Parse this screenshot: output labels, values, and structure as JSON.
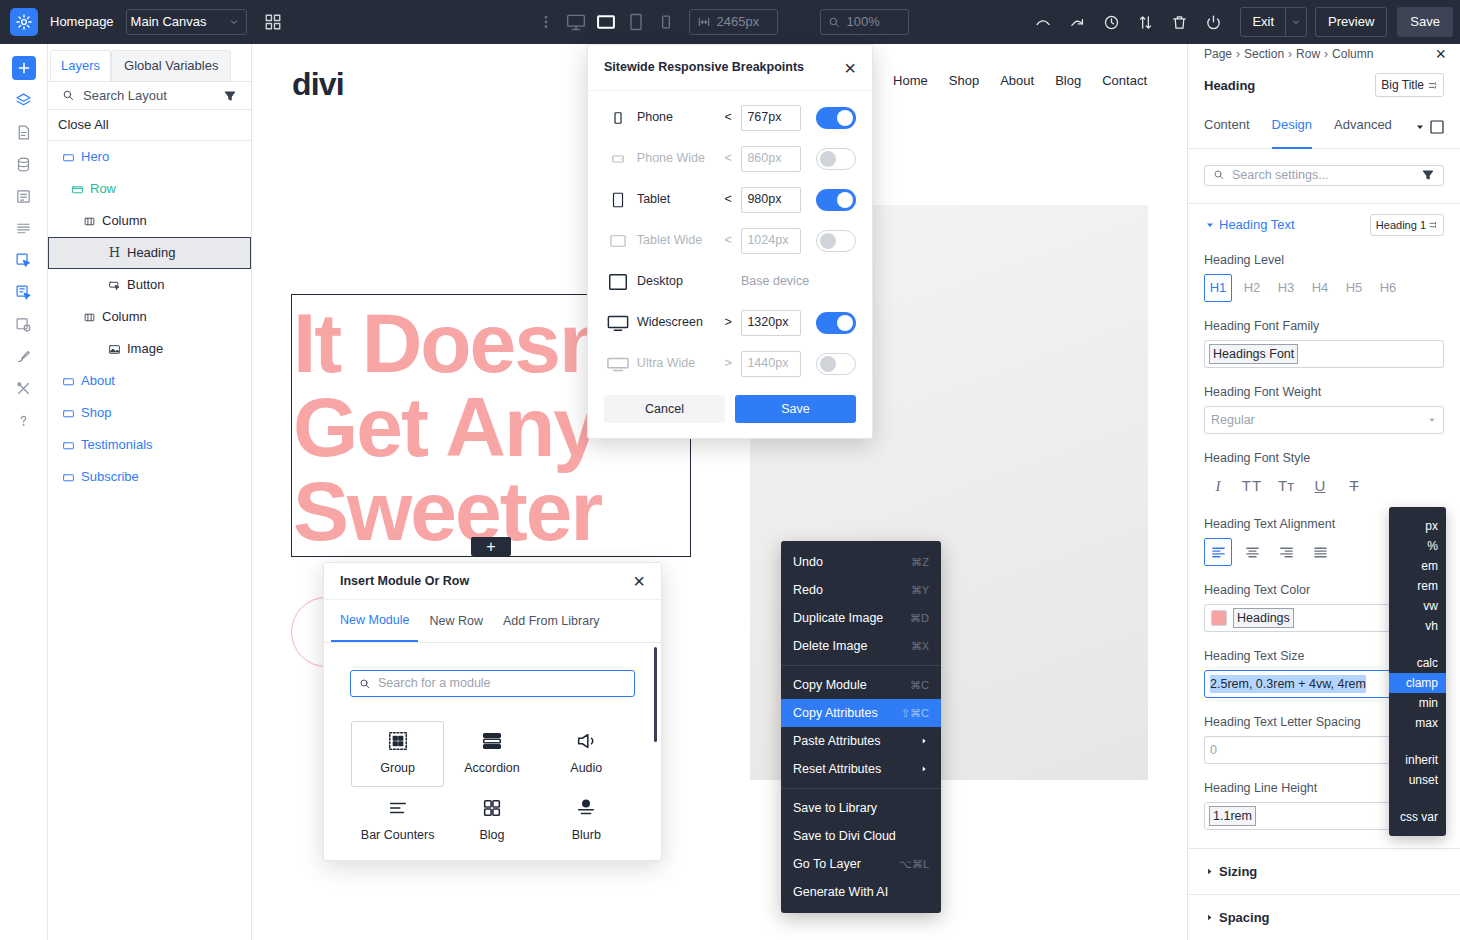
{
  "topbar": {
    "page_title": "Homepage",
    "canvas": "Main Canvas",
    "devices": [
      {
        "kind": "desktop",
        "selected": false
      },
      {
        "kind": "tablet-landscape",
        "selected": true
      },
      {
        "kind": "tablet",
        "selected": false
      },
      {
        "kind": "phone",
        "selected": false
      }
    ],
    "width": "2465px",
    "zoom": "100%",
    "exit": "Exit",
    "preview": "Preview",
    "save": "Save"
  },
  "rail": [
    {
      "kind": "add",
      "selected": false
    },
    {
      "kind": "tool",
      "selected": true
    },
    {
      "kind": "tool",
      "selected": false
    },
    {
      "kind": "tool",
      "selected": false
    },
    {
      "kind": "tool",
      "selected": false
    },
    {
      "kind": "tool",
      "selected": false
    },
    {
      "kind": "tool",
      "selected": true
    },
    {
      "kind": "tool",
      "selected": true
    },
    {
      "kind": "tool",
      "selected": false
    },
    {
      "kind": "tool",
      "selected": false
    },
    {
      "kind": "tool",
      "selected": false
    },
    {
      "kind": "tool",
      "selected": false
    }
  ],
  "layers": {
    "tabs": [
      {
        "label": "Layers",
        "selected": true
      },
      {
        "label": "Global Variables",
        "selected": false
      }
    ],
    "search": "Search Layout",
    "close_all": "Close All",
    "tree": [
      {
        "label": "Hero",
        "kind": "section",
        "depth": 0,
        "selected": false
      },
      {
        "label": "Row",
        "kind": "row",
        "depth": 1,
        "selected": false
      },
      {
        "label": "Column",
        "kind": "column",
        "depth": 2,
        "selected": false
      },
      {
        "label": "Heading",
        "kind": "heading",
        "glyph": "H",
        "depth": 3,
        "selected": true
      },
      {
        "label": "Button",
        "kind": "button",
        "depth": 3,
        "selected": false
      },
      {
        "label": "Column",
        "kind": "column",
        "depth": 2,
        "selected": false
      },
      {
        "label": "Image",
        "kind": "image",
        "depth": 3,
        "selected": false
      },
      {
        "label": "About",
        "kind": "section",
        "depth": 0,
        "selected": false
      },
      {
        "label": "Shop",
        "kind": "section",
        "depth": 0,
        "selected": false
      },
      {
        "label": "Testimonials",
        "kind": "section",
        "depth": 0,
        "selected": false
      },
      {
        "label": "Subscribe",
        "kind": "section",
        "depth": 0,
        "selected": false
      }
    ]
  },
  "canvas": {
    "logo": "divi",
    "nav": [
      "Home",
      "Shop",
      "About",
      "Blog",
      "Contact"
    ],
    "heading": [
      "It Doesn",
      "Get Any",
      "Sweeter"
    ],
    "add": "+"
  },
  "breakpoints": {
    "title": "Sitewide Responsive Breakpoints",
    "close": "×",
    "rows": [
      {
        "name": "Phone",
        "kind": "range",
        "op": "<",
        "value": "767px",
        "enabled": true
      },
      {
        "name": "Phone Wide",
        "kind": "range",
        "op": "<",
        "value": "860px",
        "enabled": false
      },
      {
        "name": "Tablet",
        "kind": "range",
        "op": "<",
        "value": "980px",
        "enabled": true
      },
      {
        "name": "Tablet Wide",
        "kind": "range",
        "op": "<",
        "value": "1024px",
        "enabled": false
      },
      {
        "name": "Desktop",
        "kind": "base",
        "note": "Base device"
      },
      {
        "name": "Widescreen",
        "kind": "range",
        "op": ">",
        "value": "1320px",
        "enabled": true
      },
      {
        "name": "Ultra Wide",
        "kind": "range",
        "op": ">",
        "value": "1440px",
        "enabled": false
      }
    ],
    "cancel": "Cancel",
    "save": "Save"
  },
  "insert": {
    "title": "Insert Module Or Row",
    "close": "×",
    "tabs": [
      {
        "label": "New Module",
        "selected": true
      },
      {
        "label": "New Row",
        "selected": false
      },
      {
        "label": "Add From Library",
        "selected": false
      }
    ],
    "search": "Search for a module",
    "modules": [
      {
        "label": "Group",
        "selected": true
      },
      {
        "label": "Accordion",
        "selected": false
      },
      {
        "label": "Audio",
        "selected": false
      },
      {
        "label": "Bar Counters",
        "selected": false
      },
      {
        "label": "Blog",
        "selected": false
      },
      {
        "label": "Blurb",
        "selected": false
      }
    ]
  },
  "context_menu": {
    "groups": [
      [
        {
          "label": "Undo",
          "shortcut": "⌘Z",
          "selected": false,
          "submenu": false
        },
        {
          "label": "Redo",
          "shortcut": "⌘Y",
          "selected": false,
          "submenu": false
        },
        {
          "label": "Duplicate Image",
          "shortcut": "⌘D",
          "selected": false,
          "submenu": false
        },
        {
          "label": "Delete Image",
          "shortcut": "⌘X",
          "selected": false,
          "submenu": false
        }
      ],
      [
        {
          "label": "Copy Module",
          "shortcut": "⌘C",
          "selected": false,
          "submenu": false
        },
        {
          "label": "Copy Attributes",
          "shortcut": "⇧⌘C",
          "selected": true,
          "submenu": false
        },
        {
          "label": "Paste Attributes",
          "selected": false,
          "submenu": true
        },
        {
          "label": "Reset Attributes",
          "selected": false,
          "submenu": true
        }
      ],
      [
        {
          "label": "Save to Library",
          "selected": false,
          "submenu": false
        },
        {
          "label": "Save to Divi Cloud",
          "selected": false,
          "submenu": false
        },
        {
          "label": "Go To Layer",
          "shortcut": "⌥⌘L",
          "selected": false,
          "submenu": false
        },
        {
          "label": "Generate With AI",
          "selected": false,
          "submenu": false
        }
      ]
    ]
  },
  "settings": {
    "breadcrumb": [
      "Page",
      "Section",
      "Row",
      "Column"
    ],
    "separator": "›",
    "close": "×",
    "title": "Heading",
    "preset": "Big Title",
    "tabs": [
      {
        "label": "Content",
        "selected": false
      },
      {
        "label": "Design",
        "selected": true
      },
      {
        "label": "Advanced",
        "selected": false
      }
    ],
    "search": "Search settings...",
    "group": {
      "label": "Heading Text",
      "expanded": true,
      "preset": "Heading 1"
    },
    "fields": [
      {
        "kind": "levels",
        "label": "Heading Level",
        "options": [
          {
            "label": "H1",
            "selected": true
          },
          {
            "label": "H2",
            "selected": false
          },
          {
            "label": "H3",
            "selected": false
          },
          {
            "label": "H4",
            "selected": false
          },
          {
            "label": "H5",
            "selected": false
          },
          {
            "label": "H6",
            "selected": false
          }
        ]
      },
      {
        "kind": "chip",
        "label": "Heading Font Family",
        "value": "Headings Font"
      },
      {
        "kind": "select",
        "label": "Heading Font Weight",
        "value": "Regular"
      },
      {
        "kind": "glyphs",
        "label": "Heading Font Style",
        "options": [
          {
            "glyph": "I",
            "kind": "italic"
          },
          {
            "glyph": "TT",
            "kind": "uppercase"
          },
          {
            "glyph": "Tт",
            "kind": "capitalize"
          },
          {
            "glyph": "U",
            "kind": "underline"
          },
          {
            "glyph": "T",
            "kind": "strikethrough"
          }
        ]
      },
      {
        "kind": "align",
        "label": "Heading Text Alignment",
        "options": [
          {
            "selected": true
          },
          {
            "selected": false
          },
          {
            "selected": false
          },
          {
            "selected": false
          }
        ]
      },
      {
        "kind": "color",
        "label": "Heading Text Color",
        "value": "Headings",
        "color": "#f4a4a4"
      },
      {
        "kind": "input",
        "label": "Heading Text Size",
        "value": "2.5rem, 0.3rem + 4vw, 4rem",
        "focused": true,
        "muted": false
      },
      {
        "kind": "input",
        "label": "Heading Text Letter Spacing",
        "value": "0",
        "focused": false,
        "muted": true
      },
      {
        "kind": "chip",
        "label": "Heading Line Height",
        "value": "1.1rem"
      }
    ],
    "sections": [
      {
        "label": "Sizing",
        "expanded": false
      },
      {
        "label": "Spacing",
        "expanded": false
      }
    ]
  },
  "units": {
    "groups": [
      [
        {
          "label": "px",
          "selected": false
        },
        {
          "label": "%",
          "selected": false
        },
        {
          "label": "em",
          "selected": false
        },
        {
          "label": "rem",
          "selected": false
        },
        {
          "label": "vw",
          "selected": false
        },
        {
          "label": "vh",
          "selected": false
        }
      ],
      [
        {
          "label": "calc",
          "selected": false
        },
        {
          "label": "clamp",
          "selected": true
        },
        {
          "label": "min",
          "selected": false
        },
        {
          "label": "max",
          "selected": false
        }
      ],
      [
        {
          "label": "inherit",
          "selected": false
        },
        {
          "label": "unset",
          "selected": false
        }
      ],
      [
        {
          "label": "css var",
          "selected": false
        }
      ]
    ]
  }
}
